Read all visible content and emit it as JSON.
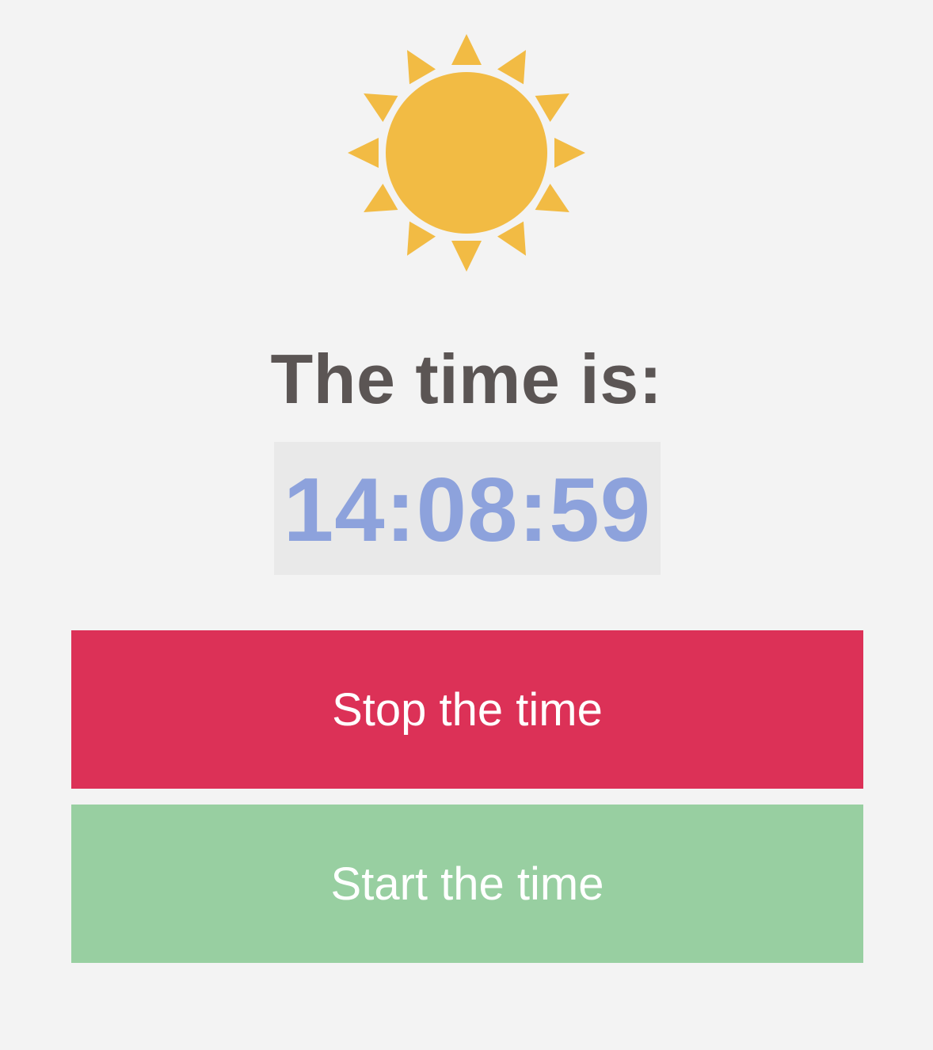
{
  "icon": "sun-icon",
  "heading": "The time is:",
  "clock": {
    "time": "14:08:59"
  },
  "buttons": {
    "stop_label": "Stop the time",
    "start_label": "Start the time"
  },
  "colors": {
    "sun": "#f2bb44",
    "heading": "#5b5554",
    "clock_text": "#8da2dc",
    "clock_bg": "#e9e9e9",
    "stop_button": "#dc3157",
    "start_button": "#98cfa1",
    "background": "#f3f3f3"
  }
}
